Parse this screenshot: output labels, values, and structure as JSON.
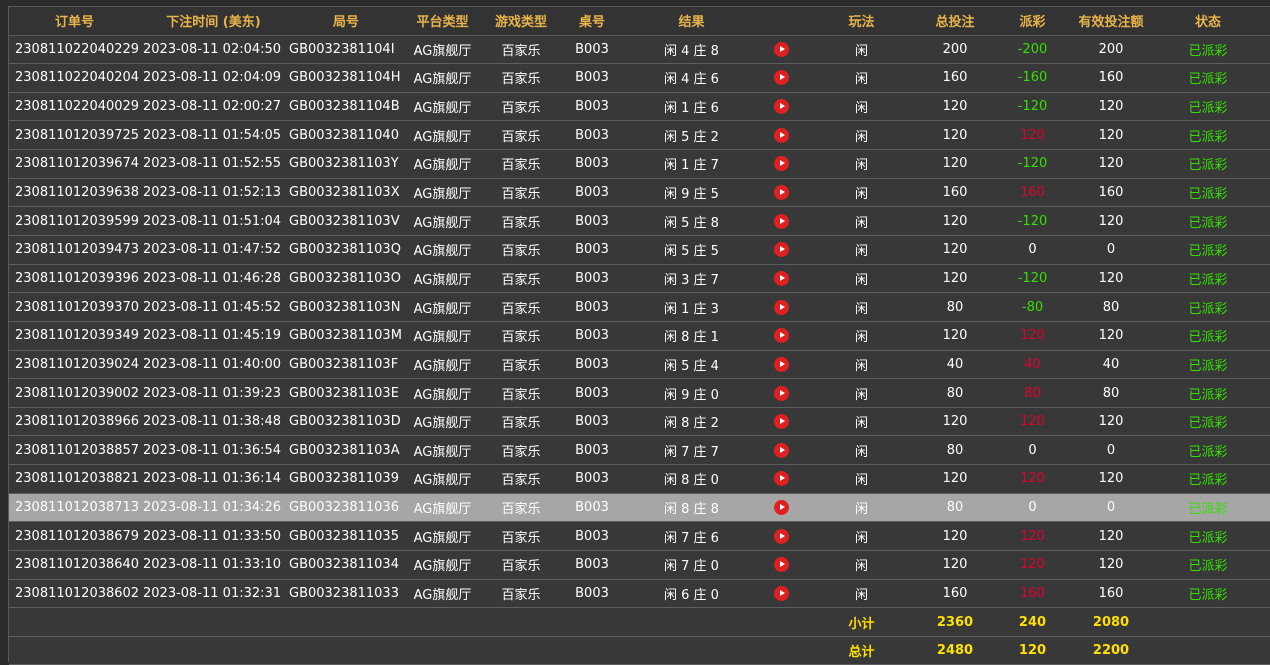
{
  "headers": {
    "order_no": "订单号",
    "bet_time": "下注时间 (美东)",
    "round_no": "局号",
    "platform": "平台类型",
    "game_type": "游戏类型",
    "table_no": "桌号",
    "result": "结果",
    "play": "玩法",
    "total_bet": "总投注",
    "payout": "派彩",
    "valid_bet": "有效投注额",
    "status": "状态"
  },
  "icons": {
    "replay": "play-circle-icon"
  },
  "colors": {
    "header_text": "#e8b44a",
    "row_text": "#ffffff",
    "row_bg": "#383838",
    "highlight_row_bg": "#a6a6a6",
    "payout_negative": "#33e000",
    "payout_positive": "#e0002c",
    "status_done": "#33e000",
    "summary_text": "#ffe000",
    "replay_icon": "#e02020"
  },
  "rows": [
    {
      "order_no": "230811022040229",
      "bet_time": "2023-08-11 02:04:50",
      "round_no": "GB0032381104I",
      "platform": "AG旗舰厅",
      "game_type": "百家乐",
      "table_no": "B003",
      "result": "闲 4 庄 8",
      "play": "闲",
      "total_bet": "200",
      "payout": "-200",
      "payout_color": "green",
      "valid_bet": "200",
      "status": "已派彩",
      "highlight": false
    },
    {
      "order_no": "230811022040204",
      "bet_time": "2023-08-11 02:04:09",
      "round_no": "GB0032381104H",
      "platform": "AG旗舰厅",
      "game_type": "百家乐",
      "table_no": "B003",
      "result": "闲 4 庄 6",
      "play": "闲",
      "total_bet": "160",
      "payout": "-160",
      "payout_color": "green",
      "valid_bet": "160",
      "status": "已派彩",
      "highlight": false
    },
    {
      "order_no": "230811022040029",
      "bet_time": "2023-08-11 02:00:27",
      "round_no": "GB0032381104B",
      "platform": "AG旗舰厅",
      "game_type": "百家乐",
      "table_no": "B003",
      "result": "闲 1 庄 6",
      "play": "闲",
      "total_bet": "120",
      "payout": "-120",
      "payout_color": "green",
      "valid_bet": "120",
      "status": "已派彩",
      "highlight": false
    },
    {
      "order_no": "230811012039725",
      "bet_time": "2023-08-11 01:54:05",
      "round_no": "GB00323811040",
      "platform": "AG旗舰厅",
      "game_type": "百家乐",
      "table_no": "B003",
      "result": "闲 5 庄 2",
      "play": "闲",
      "total_bet": "120",
      "payout": "120",
      "payout_color": "red",
      "valid_bet": "120",
      "status": "已派彩",
      "highlight": false
    },
    {
      "order_no": "230811012039674",
      "bet_time": "2023-08-11 01:52:55",
      "round_no": "GB0032381103Y",
      "platform": "AG旗舰厅",
      "game_type": "百家乐",
      "table_no": "B003",
      "result": "闲 1 庄 7",
      "play": "闲",
      "total_bet": "120",
      "payout": "-120",
      "payout_color": "green",
      "valid_bet": "120",
      "status": "已派彩",
      "highlight": false
    },
    {
      "order_no": "230811012039638",
      "bet_time": "2023-08-11 01:52:13",
      "round_no": "GB0032381103X",
      "platform": "AG旗舰厅",
      "game_type": "百家乐",
      "table_no": "B003",
      "result": "闲 9 庄 5",
      "play": "闲",
      "total_bet": "160",
      "payout": "160",
      "payout_color": "red",
      "valid_bet": "160",
      "status": "已派彩",
      "highlight": false
    },
    {
      "order_no": "230811012039599",
      "bet_time": "2023-08-11 01:51:04",
      "round_no": "GB0032381103V",
      "platform": "AG旗舰厅",
      "game_type": "百家乐",
      "table_no": "B003",
      "result": "闲 5 庄 8",
      "play": "闲",
      "total_bet": "120",
      "payout": "-120",
      "payout_color": "green",
      "valid_bet": "120",
      "status": "已派彩",
      "highlight": false
    },
    {
      "order_no": "230811012039473",
      "bet_time": "2023-08-11 01:47:52",
      "round_no": "GB0032381103Q",
      "platform": "AG旗舰厅",
      "game_type": "百家乐",
      "table_no": "B003",
      "result": "闲 5 庄 5",
      "play": "闲",
      "total_bet": "120",
      "payout": "0",
      "payout_color": "white",
      "valid_bet": "0",
      "status": "已派彩",
      "highlight": false
    },
    {
      "order_no": "230811012039396",
      "bet_time": "2023-08-11 01:46:28",
      "round_no": "GB0032381103O",
      "platform": "AG旗舰厅",
      "game_type": "百家乐",
      "table_no": "B003",
      "result": "闲 3 庄 7",
      "play": "闲",
      "total_bet": "120",
      "payout": "-120",
      "payout_color": "green",
      "valid_bet": "120",
      "status": "已派彩",
      "highlight": false
    },
    {
      "order_no": "230811012039370",
      "bet_time": "2023-08-11 01:45:52",
      "round_no": "GB0032381103N",
      "platform": "AG旗舰厅",
      "game_type": "百家乐",
      "table_no": "B003",
      "result": "闲 1 庄 3",
      "play": "闲",
      "total_bet": "80",
      "payout": "-80",
      "payout_color": "green",
      "valid_bet": "80",
      "status": "已派彩",
      "highlight": false
    },
    {
      "order_no": "230811012039349",
      "bet_time": "2023-08-11 01:45:19",
      "round_no": "GB0032381103M",
      "platform": "AG旗舰厅",
      "game_type": "百家乐",
      "table_no": "B003",
      "result": "闲 8 庄 1",
      "play": "闲",
      "total_bet": "120",
      "payout": "120",
      "payout_color": "red",
      "valid_bet": "120",
      "status": "已派彩",
      "highlight": false
    },
    {
      "order_no": "230811012039024",
      "bet_time": "2023-08-11 01:40:00",
      "round_no": "GB0032381103F",
      "platform": "AG旗舰厅",
      "game_type": "百家乐",
      "table_no": "B003",
      "result": "闲 5 庄 4",
      "play": "闲",
      "total_bet": "40",
      "payout": "40",
      "payout_color": "red",
      "valid_bet": "40",
      "status": "已派彩",
      "highlight": false
    },
    {
      "order_no": "230811012039002",
      "bet_time": "2023-08-11 01:39:23",
      "round_no": "GB0032381103E",
      "platform": "AG旗舰厅",
      "game_type": "百家乐",
      "table_no": "B003",
      "result": "闲 9 庄 0",
      "play": "闲",
      "total_bet": "80",
      "payout": "80",
      "payout_color": "red",
      "valid_bet": "80",
      "status": "已派彩",
      "highlight": false
    },
    {
      "order_no": "230811012038966",
      "bet_time": "2023-08-11 01:38:48",
      "round_no": "GB0032381103D",
      "platform": "AG旗舰厅",
      "game_type": "百家乐",
      "table_no": "B003",
      "result": "闲 8 庄 2",
      "play": "闲",
      "total_bet": "120",
      "payout": "120",
      "payout_color": "red",
      "valid_bet": "120",
      "status": "已派彩",
      "highlight": false
    },
    {
      "order_no": "230811012038857",
      "bet_time": "2023-08-11 01:36:54",
      "round_no": "GB0032381103A",
      "platform": "AG旗舰厅",
      "game_type": "百家乐",
      "table_no": "B003",
      "result": "闲 7 庄 7",
      "play": "闲",
      "total_bet": "80",
      "payout": "0",
      "payout_color": "white",
      "valid_bet": "0",
      "status": "已派彩",
      "highlight": false
    },
    {
      "order_no": "230811012038821",
      "bet_time": "2023-08-11 01:36:14",
      "round_no": "GB00323811039",
      "platform": "AG旗舰厅",
      "game_type": "百家乐",
      "table_no": "B003",
      "result": "闲 8 庄 0",
      "play": "闲",
      "total_bet": "120",
      "payout": "120",
      "payout_color": "red",
      "valid_bet": "120",
      "status": "已派彩",
      "highlight": false
    },
    {
      "order_no": "230811012038713",
      "bet_time": "2023-08-11 01:34:26",
      "round_no": "GB00323811036",
      "platform": "AG旗舰厅",
      "game_type": "百家乐",
      "table_no": "B003",
      "result": "闲 8 庄 8",
      "play": "闲",
      "total_bet": "80",
      "payout": "0",
      "payout_color": "white",
      "valid_bet": "0",
      "status": "已派彩",
      "highlight": true
    },
    {
      "order_no": "230811012038679",
      "bet_time": "2023-08-11 01:33:50",
      "round_no": "GB00323811035",
      "platform": "AG旗舰厅",
      "game_type": "百家乐",
      "table_no": "B003",
      "result": "闲 7 庄 6",
      "play": "闲",
      "total_bet": "120",
      "payout": "120",
      "payout_color": "red",
      "valid_bet": "120",
      "status": "已派彩",
      "highlight": false
    },
    {
      "order_no": "230811012038640",
      "bet_time": "2023-08-11 01:33:10",
      "round_no": "GB00323811034",
      "platform": "AG旗舰厅",
      "game_type": "百家乐",
      "table_no": "B003",
      "result": "闲 7 庄 0",
      "play": "闲",
      "total_bet": "120",
      "payout": "120",
      "payout_color": "red",
      "valid_bet": "120",
      "status": "已派彩",
      "highlight": false
    },
    {
      "order_no": "230811012038602",
      "bet_time": "2023-08-11 01:32:31",
      "round_no": "GB00323811033",
      "platform": "AG旗舰厅",
      "game_type": "百家乐",
      "table_no": "B003",
      "result": "闲 6 庄 0",
      "play": "闲",
      "total_bet": "160",
      "payout": "160",
      "payout_color": "red",
      "valid_bet": "160",
      "status": "已派彩",
      "highlight": false
    }
  ],
  "subtotal": {
    "label": "小计",
    "total_bet": "2360",
    "payout": "240",
    "valid_bet": "2080"
  },
  "grand_total": {
    "label": "总计",
    "total_bet": "2480",
    "payout": "120",
    "valid_bet": "2200"
  }
}
